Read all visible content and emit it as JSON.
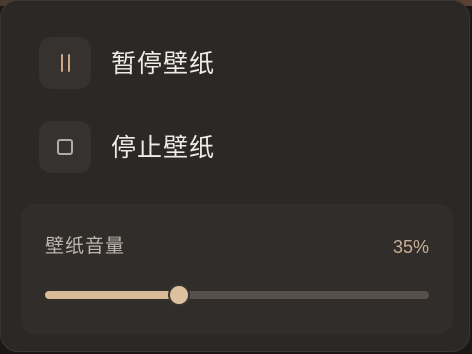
{
  "menu": {
    "pause": {
      "label": "暂停壁纸",
      "icon": "pause-icon"
    },
    "stop": {
      "label": "停止壁纸",
      "icon": "stop-icon"
    }
  },
  "volume": {
    "label": "壁纸音量",
    "value_text": "35%",
    "value": 0.35
  },
  "colors": {
    "panel_bg": "#2b2826",
    "accent": "#d9bb97",
    "track": "#57504a"
  }
}
